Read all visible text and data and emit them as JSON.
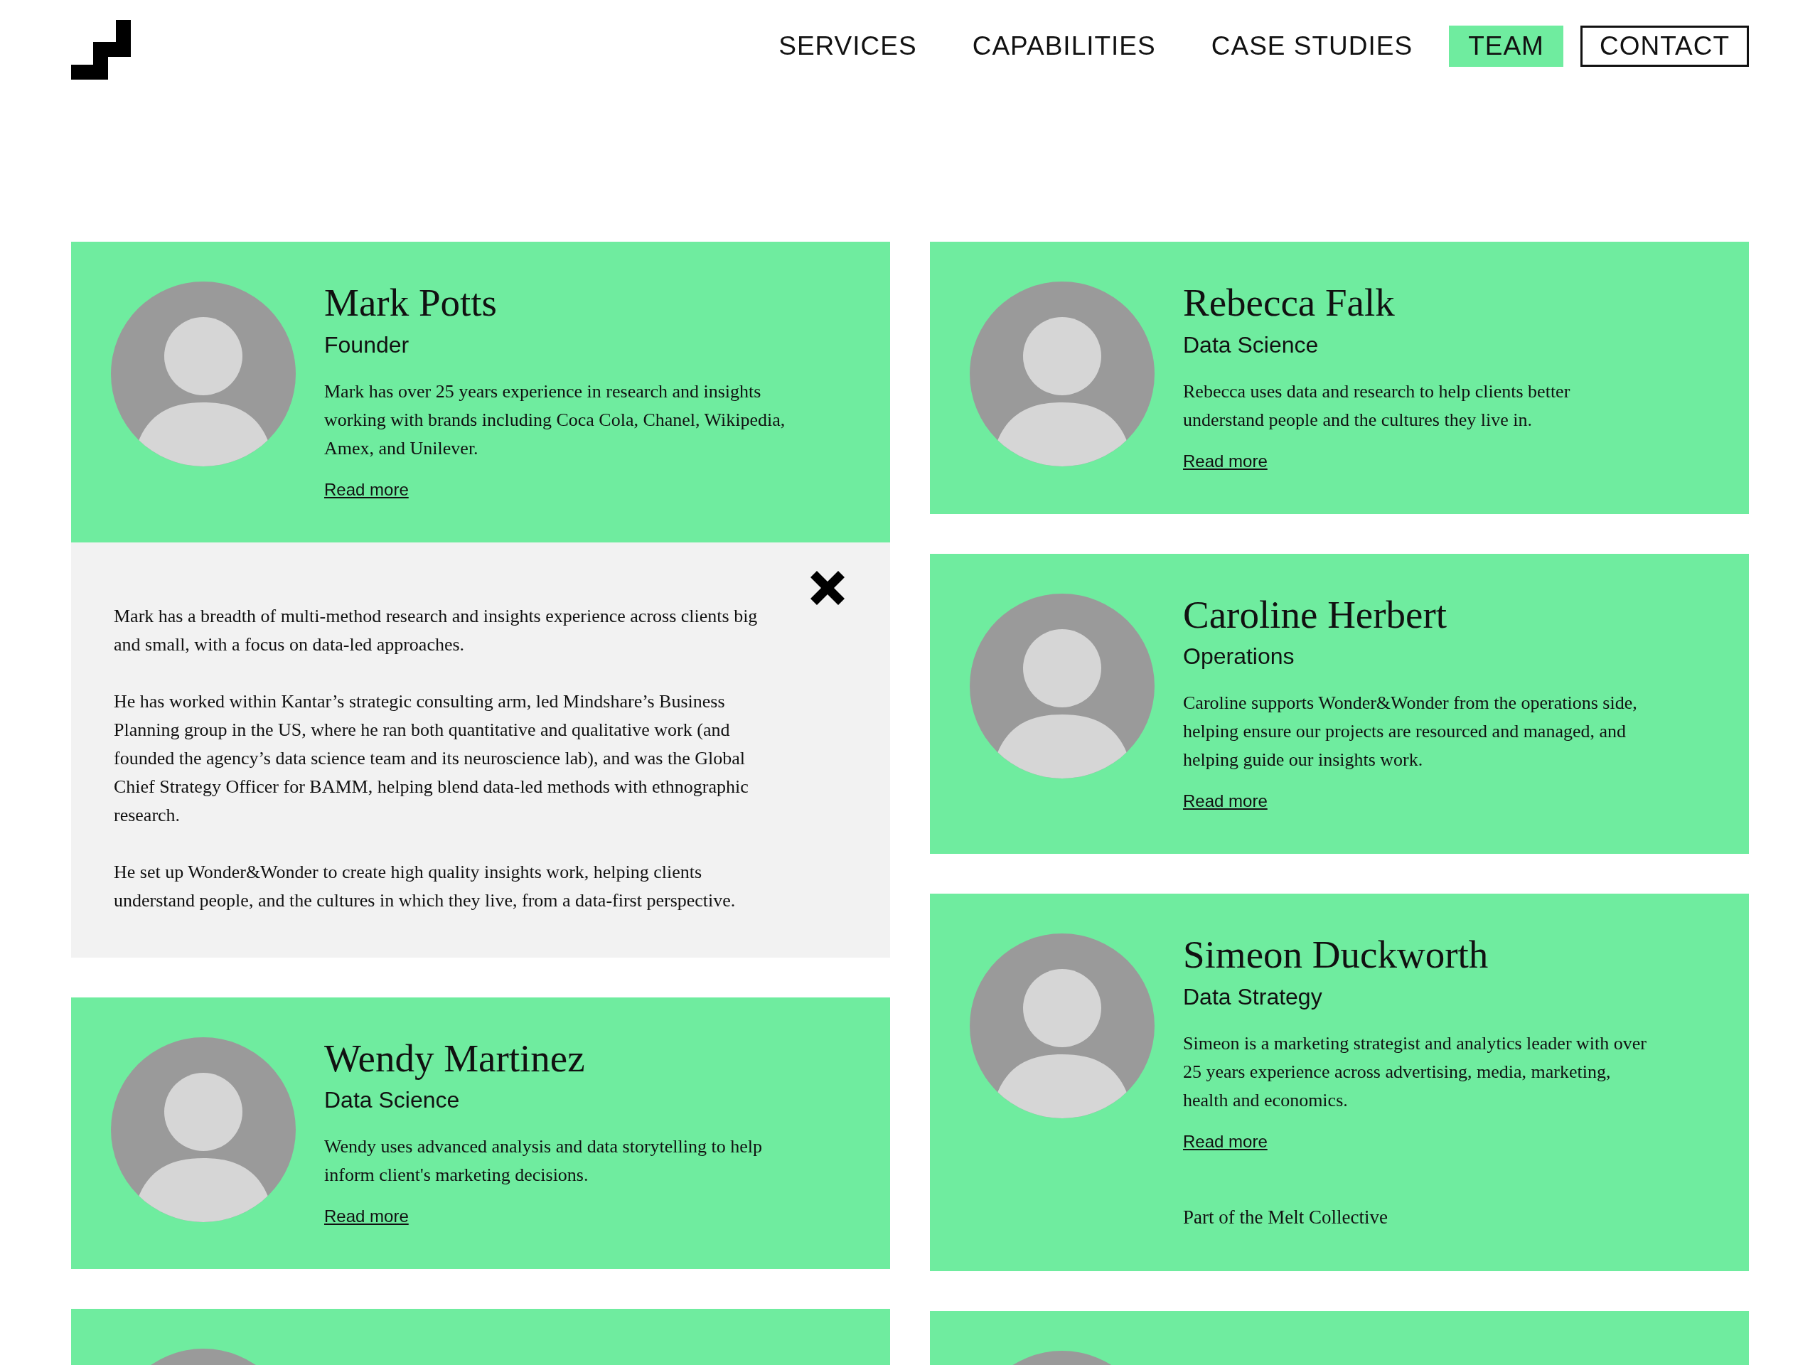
{
  "nav": [
    {
      "label": "SERVICES",
      "selected": false,
      "kind": "plain"
    },
    {
      "label": "CAPABILITIES",
      "selected": false,
      "kind": "plain"
    },
    {
      "label": "CASE STUDIES",
      "selected": false,
      "kind": "plain"
    },
    {
      "label": "TEAM",
      "selected": true,
      "kind": "plain"
    },
    {
      "label": "CONTACT",
      "selected": false,
      "kind": "outlined"
    }
  ],
  "columns": [
    {
      "members": [
        {
          "kind": "card",
          "name": "Mark Potts",
          "role": "Founder",
          "bio": "Mark has over 25 years experience in research and insights working with brands including Coca Cola, Chanel, Wikipedia, Amex, and Unilever.",
          "link": "Read more",
          "details": [
            "Mark has a breadth of multi-method research and insights experience across clients big and small, with a focus on data-led approaches.",
            "He has worked within Kantar’s strategic consulting arm, led Mindshare’s Business Planning group in the US, where he ran both quantitative and qualitative work (and founded the agency’s data science team and its neuroscience lab), and was the Global Chief Strategy Officer for BAMM, helping blend data-led methods with ethnographic research.",
            "He set up Wonder&Wonder to create high quality insights work, helping clients understand people, and the cultures in which they live, from a data-first perspective."
          ]
        },
        {
          "kind": "card",
          "name": "Wendy Martinez",
          "role": "Data Science",
          "bio": "Wendy uses advanced analysis and data storytelling to help inform client's marketing decisions.",
          "link": "Read more"
        },
        {
          "kind": "cut"
        }
      ]
    },
    {
      "members": [
        {
          "kind": "card",
          "name": "Rebecca Falk",
          "role": "Data Science",
          "bio": "Rebecca uses data and research to help clients better understand people and the cultures they live in.",
          "link": "Read more"
        },
        {
          "kind": "card",
          "name": "Caroline Herbert",
          "role": "Operations",
          "bio": "Caroline supports Wonder&Wonder from the operations side, helping ensure our projects are resourced and managed, and helping guide our insights work.",
          "link": "Read more"
        },
        {
          "kind": "card",
          "name": "Simeon Duckworth",
          "role": "Data Strategy",
          "bio": "Simeon is a marketing strategist and analytics leader with over 25 years experience across advertising, media, marketing, health and economics.",
          "link": "Read more",
          "note": "Part of the Melt Collective"
        },
        {
          "kind": "cut"
        }
      ]
    }
  ]
}
